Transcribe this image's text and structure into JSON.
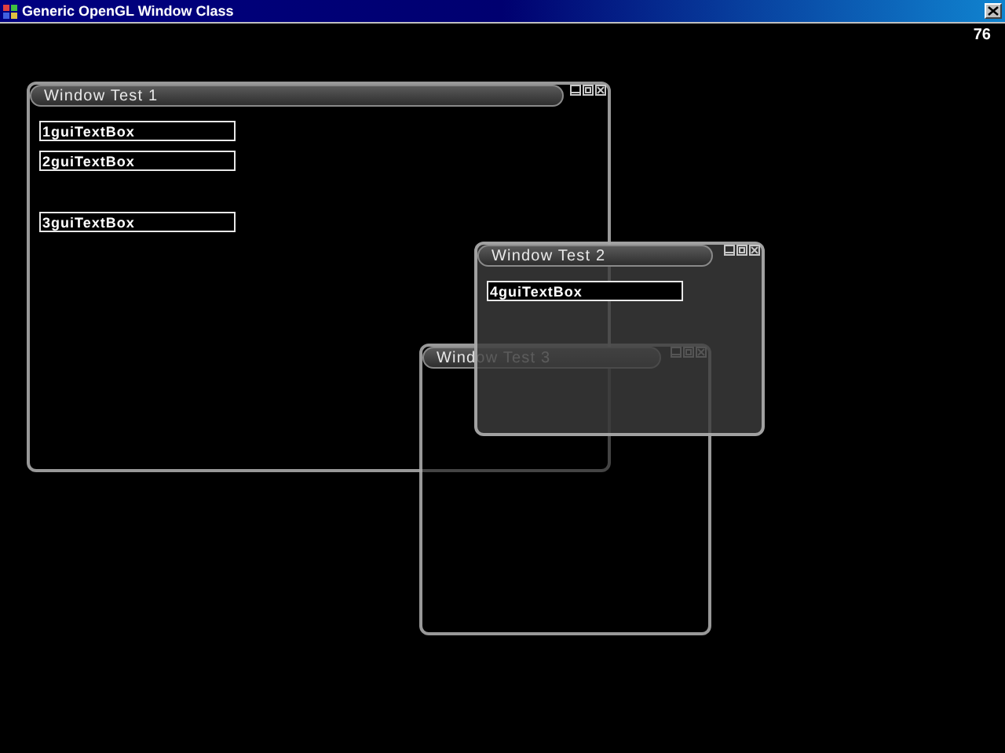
{
  "window": {
    "title": "Generic OpenGL Window Class"
  },
  "fps": "76",
  "gui_windows": [
    {
      "title": "Window Test 1",
      "text_boxes": [
        {
          "value": "1guiTextBox"
        },
        {
          "value": "2guiTextBox"
        },
        {
          "value": "3guiTextBox"
        }
      ]
    },
    {
      "title": "Window Test 3"
    },
    {
      "title": "Window Test 2",
      "text_boxes": [
        {
          "value": "4guiTextBox"
        }
      ]
    }
  ]
}
